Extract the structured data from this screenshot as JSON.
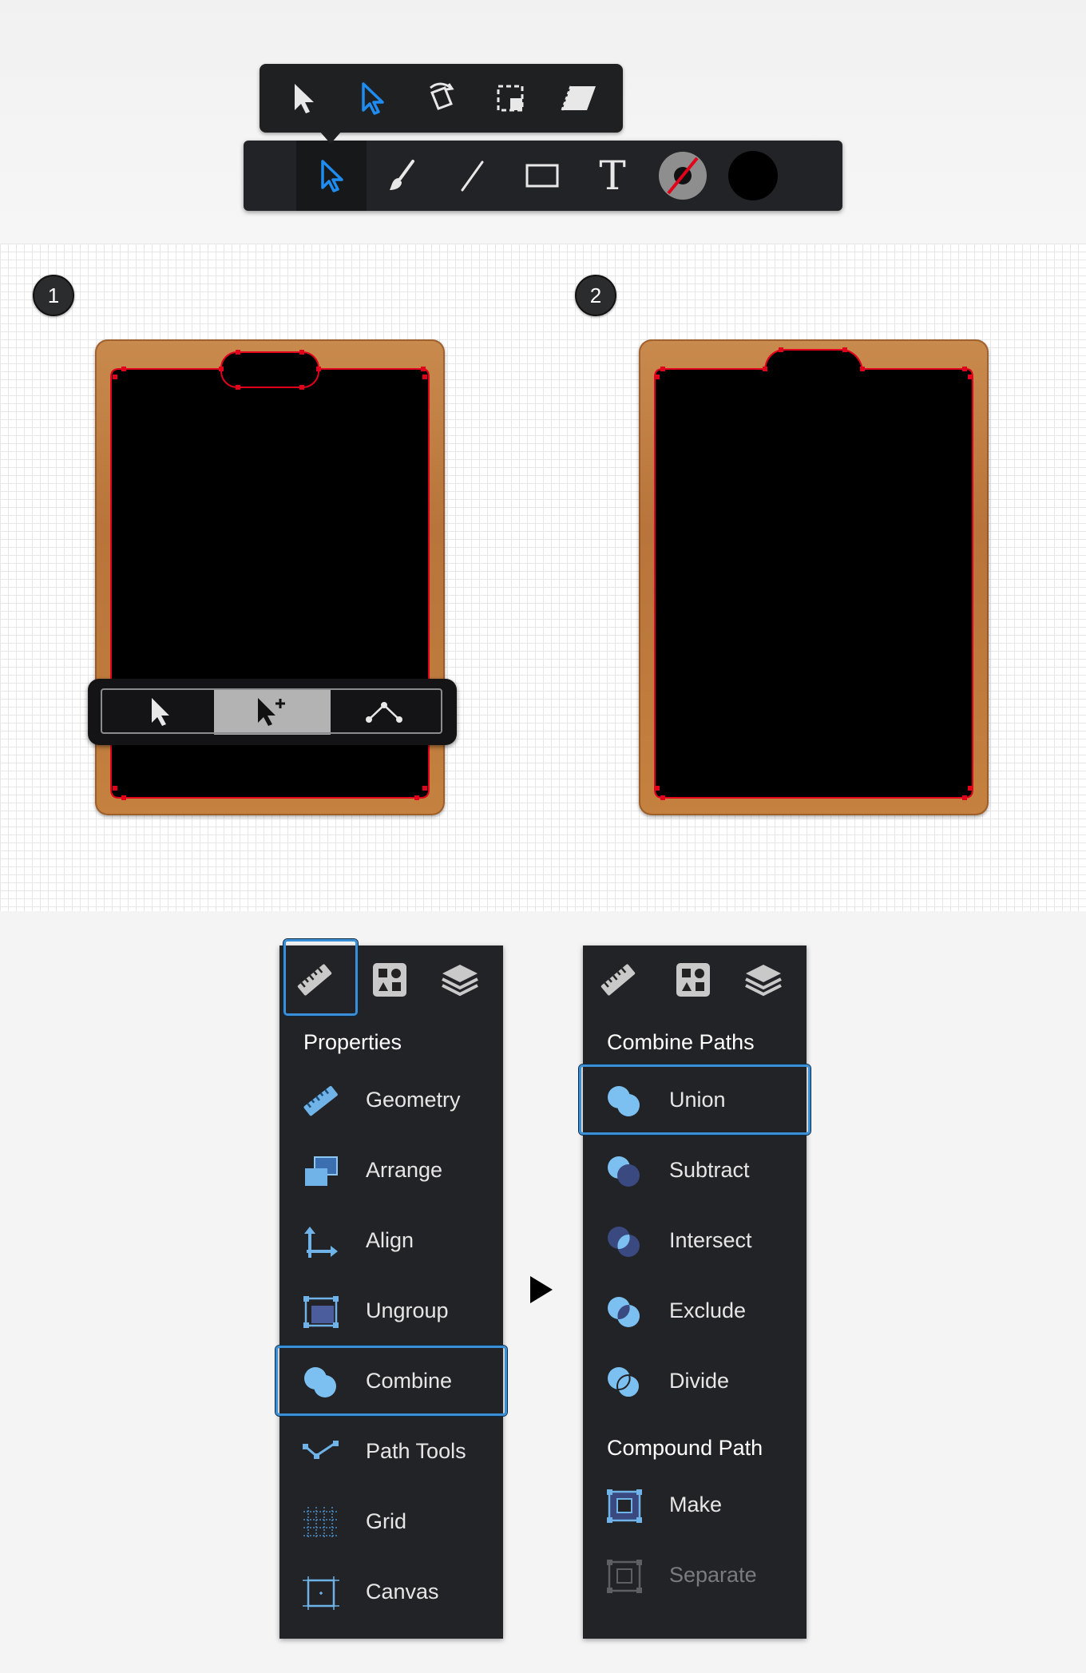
{
  "toolbar": {
    "popover_tools": [
      "select-icon",
      "direct-select-icon",
      "rotate-icon",
      "marquee-icon",
      "skew-icon"
    ],
    "main_tools": [
      "direct-select-icon",
      "brush-icon",
      "line-icon",
      "rectangle-icon",
      "text-icon",
      "stroke-swatch-icon",
      "fill-swatch-icon"
    ],
    "text_tool_glyph": "T",
    "fill_color": "#000000",
    "accent": "#1e8cf0"
  },
  "canvas": {
    "steps": [
      "1",
      "2"
    ],
    "path_color": "#e3001b",
    "subtools": [
      "select-icon",
      "add-point-select-icon",
      "node-icon"
    ]
  },
  "properties_panel": {
    "title": "Properties",
    "tabs": [
      "ruler-icon",
      "shapes-icon",
      "layers-icon"
    ],
    "items": [
      {
        "label": "Geometry",
        "icon": "ruler-icon"
      },
      {
        "label": "Arrange",
        "icon": "arrange-icon"
      },
      {
        "label": "Align",
        "icon": "align-icon"
      },
      {
        "label": "Ungroup",
        "icon": "ungroup-icon"
      },
      {
        "label": "Combine",
        "icon": "combine-icon",
        "selected": true
      },
      {
        "label": "Path Tools",
        "icon": "path-tools-icon"
      },
      {
        "label": "Grid",
        "icon": "grid-icon"
      },
      {
        "label": "Canvas",
        "icon": "canvas-icon"
      }
    ]
  },
  "combine_panel": {
    "title": "Combine Paths",
    "items": [
      {
        "label": "Union",
        "icon": "union-icon",
        "selected": true
      },
      {
        "label": "Subtract",
        "icon": "subtract-icon"
      },
      {
        "label": "Intersect",
        "icon": "intersect-icon"
      },
      {
        "label": "Exclude",
        "icon": "exclude-icon"
      },
      {
        "label": "Divide",
        "icon": "divide-icon"
      }
    ],
    "compound_title": "Compound Path",
    "compound_items": [
      {
        "label": "Make",
        "icon": "make-compound-icon"
      },
      {
        "label": "Separate",
        "icon": "separate-compound-icon",
        "disabled": true
      }
    ]
  }
}
